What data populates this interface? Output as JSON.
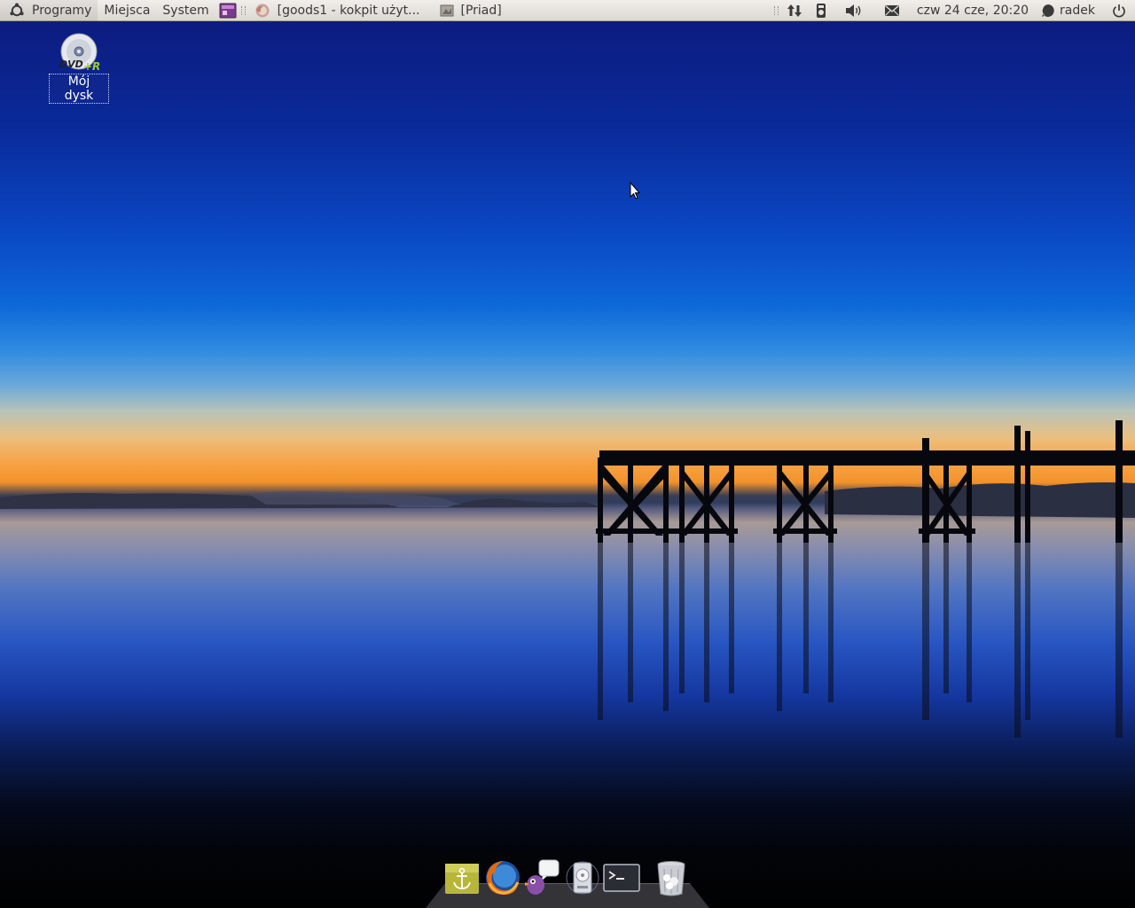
{
  "top_panel": {
    "menus": [
      {
        "label": "Programy"
      },
      {
        "label": "Miejsca"
      },
      {
        "label": "System"
      }
    ],
    "tasks": [
      {
        "label": "[goods1 - kokpit użyt...",
        "icon": "firefox-icon"
      },
      {
        "label": "[Priad]",
        "icon": "window-icon"
      }
    ],
    "clock": "czw 24 cze, 20:20",
    "user": "radek"
  },
  "desktop": {
    "icons": [
      {
        "label": "Mój dysk",
        "icon": "dvd-r-icon"
      }
    ]
  },
  "dock": {
    "items": [
      {
        "name": "anchor-icon"
      },
      {
        "name": "firefox-icon"
      },
      {
        "name": "pidgin-icon"
      },
      {
        "name": "disk-utility-icon"
      },
      {
        "name": "terminal-icon"
      },
      {
        "name": "trash-icon"
      }
    ]
  },
  "colors": {
    "panel_bg": "#e6e3de",
    "sky_top": "#0c1c80",
    "horizon": "#f7a142"
  }
}
